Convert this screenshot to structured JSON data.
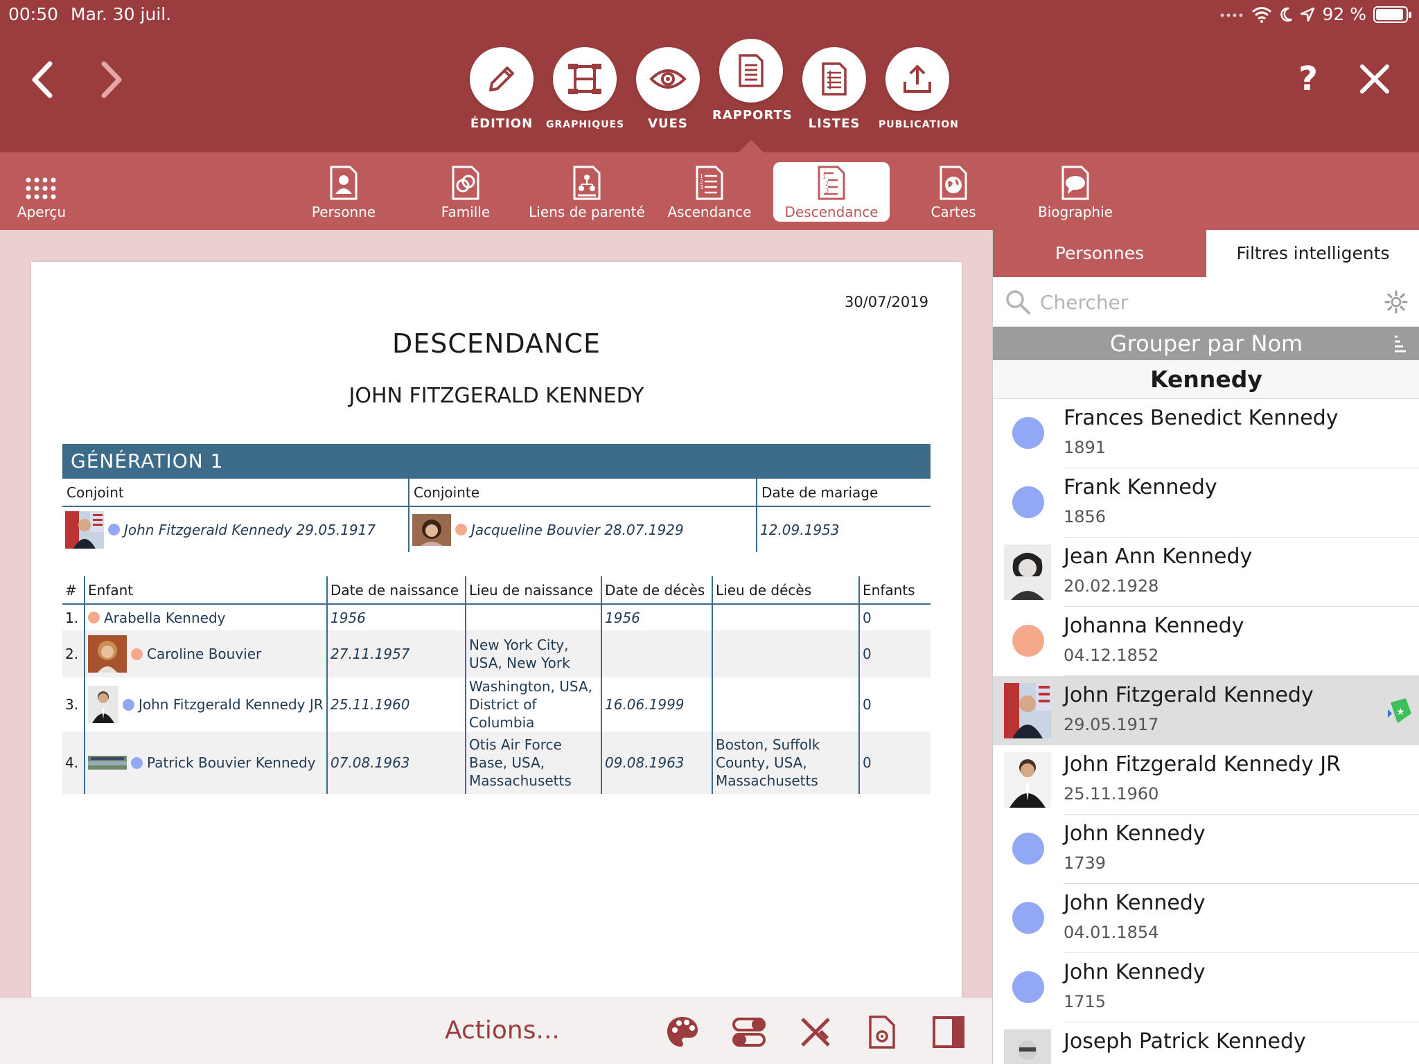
{
  "status": {
    "time": "00:50",
    "date": "Mar. 30 juil.",
    "battery": "92 %",
    "battery_level": 0.92
  },
  "toolbar": {
    "modes": [
      {
        "label": "ÉDITION",
        "icon": "pencil-icon"
      },
      {
        "label": "GRAPHIQUES",
        "icon": "chart-tree-icon"
      },
      {
        "label": "VUES",
        "icon": "eye-icon"
      },
      {
        "label": "RAPPORTS",
        "icon": "report-icon",
        "active": true
      },
      {
        "label": "LISTES",
        "icon": "list-icon"
      },
      {
        "label": "PUBLICATION",
        "icon": "upload-icon"
      }
    ],
    "help_label": "?",
    "close_label": "✕"
  },
  "tabs": [
    {
      "label": "Aperçu",
      "icon": "grid-icon"
    },
    {
      "label": "Personne",
      "icon": "person-report-icon"
    },
    {
      "label": "Famille",
      "icon": "family-report-icon"
    },
    {
      "label": "Liens de parenté",
      "icon": "relationship-report-icon"
    },
    {
      "label": "Ascendance",
      "icon": "ancestry-report-icon"
    },
    {
      "label": "Descendance",
      "icon": "descendancy-report-icon",
      "active": true
    },
    {
      "label": "Cartes",
      "icon": "globe-report-icon"
    },
    {
      "label": "Biographie",
      "icon": "speech-report-icon"
    }
  ],
  "report": {
    "date": "30/07/2019",
    "title": "DESCENDANCE",
    "subtitle": "JOHN FITZGERALD KENNEDY",
    "generation_label": "GÉNÉRATION 1",
    "couple_headers": [
      "Conjoint",
      "Conjointe",
      "Date de mariage"
    ],
    "couple": {
      "husband": "John Fitzgerald Kennedy 29.05.1917",
      "wife": "Jacqueline Bouvier 28.07.1929",
      "marriage_date": "12.09.1953"
    },
    "children_headers": [
      "#",
      "Enfant",
      "Date de naissance",
      "Lieu de naissance",
      "Date de décès",
      "Lieu de décès",
      "Enfants"
    ],
    "children": [
      {
        "index": "1.",
        "name": "Arabella Kennedy",
        "sex": "f",
        "birth_date": "1956",
        "birth_place": "",
        "death_date": "1956",
        "death_place": "",
        "children": "0"
      },
      {
        "index": "2.",
        "name": "Caroline Bouvier",
        "sex": "f",
        "birth_date": "27.11.1957",
        "birth_place": "New York City, USA, New York",
        "death_date": "",
        "death_place": "",
        "children": "0"
      },
      {
        "index": "3.",
        "name": "John Fitzgerald Kennedy JR",
        "sex": "m",
        "birth_date": "25.11.1960",
        "birth_place": "Washington, USA, District of Columbia",
        "death_date": "16.06.1999",
        "death_place": "",
        "children": "0"
      },
      {
        "index": "4.",
        "name": "Patrick Bouvier Kennedy",
        "sex": "m",
        "birth_date": "07.08.1963",
        "birth_place": "Otis Air Force Base, USA, Massachusetts",
        "death_date": "09.08.1963",
        "death_place": "Boston, Suffolk County, USA, Massachusetts",
        "children": "0"
      }
    ]
  },
  "bottombar": {
    "actions_label": "Actions..."
  },
  "panel": {
    "segments": [
      "Personnes",
      "Filtres intelligents"
    ],
    "search_placeholder": "Chercher",
    "group_label": "Grouper par Nom",
    "group_name": "Kennedy",
    "persons": [
      {
        "name": "Frances Benedict Kennedy",
        "date": "1891",
        "avatar": "m"
      },
      {
        "name": "Frank Kennedy",
        "date": "1856",
        "avatar": "m"
      },
      {
        "name": "Jean Ann Kennedy",
        "date": "20.02.1928",
        "avatar": "photo"
      },
      {
        "name": "Johanna Kennedy",
        "date": "04.12.1852",
        "avatar": "f"
      },
      {
        "name": "John Fitzgerald Kennedy",
        "date": "29.05.1917",
        "avatar": "photo",
        "selected": true
      },
      {
        "name": "John Fitzgerald Kennedy JR",
        "date": "25.11.1960",
        "avatar": "photo"
      },
      {
        "name": "John Kennedy",
        "date": "1739",
        "avatar": "m"
      },
      {
        "name": "John Kennedy",
        "date": "04.01.1854",
        "avatar": "m"
      },
      {
        "name": "John Kennedy",
        "date": "1715",
        "avatar": "m"
      },
      {
        "name": "Joseph Patrick Kennedy",
        "date": "",
        "avatar": "photo"
      }
    ]
  },
  "colors": {
    "header": "#9b3d3e",
    "tabbar": "#bd5b5c",
    "generation_bar": "#3d6c8b",
    "male": "#93a8f4",
    "female": "#f5a98b"
  }
}
